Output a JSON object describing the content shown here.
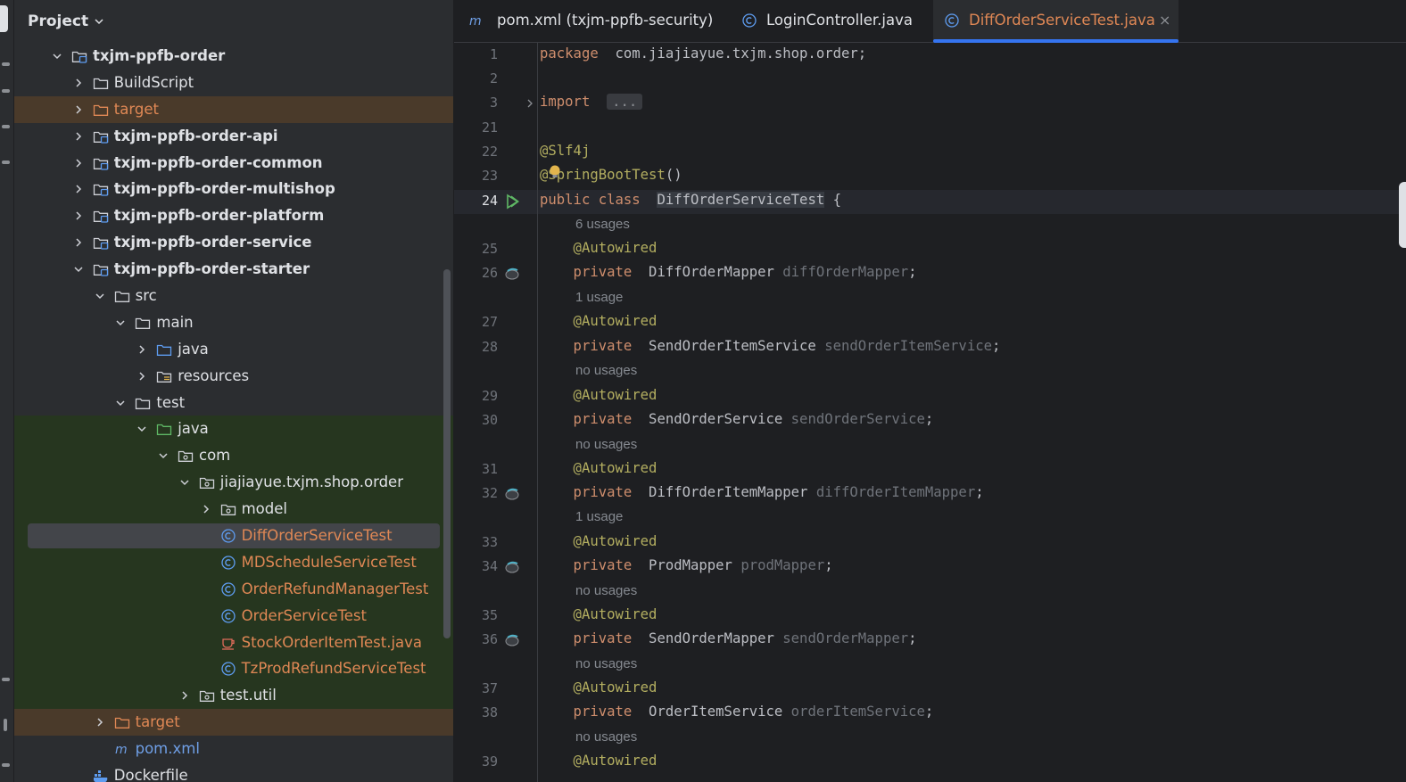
{
  "project_panel": {
    "title": "Project",
    "tree": [
      {
        "label": "txjm-ppfb-order",
        "depth": 1,
        "expanded": true,
        "icon": "module-folder-icon",
        "bold": true
      },
      {
        "label": "BuildScript",
        "depth": 2,
        "expanded": false,
        "icon": "folder-icon"
      },
      {
        "label": "target",
        "depth": 2,
        "expanded": false,
        "icon": "excluded-folder-icon",
        "state": "excluded"
      },
      {
        "label": "txjm-ppfb-order-api",
        "depth": 2,
        "expanded": false,
        "icon": "module-folder-icon",
        "bold": true
      },
      {
        "label": "txjm-ppfb-order-common",
        "depth": 2,
        "expanded": false,
        "icon": "module-folder-icon",
        "bold": true
      },
      {
        "label": "txjm-ppfb-order-multishop",
        "depth": 2,
        "expanded": false,
        "icon": "module-folder-icon",
        "bold": true
      },
      {
        "label": "txjm-ppfb-order-platform",
        "depth": 2,
        "expanded": false,
        "icon": "module-folder-icon",
        "bold": true
      },
      {
        "label": "txjm-ppfb-order-service",
        "depth": 2,
        "expanded": false,
        "icon": "module-folder-icon",
        "bold": true
      },
      {
        "label": "txjm-ppfb-order-starter",
        "depth": 2,
        "expanded": true,
        "icon": "module-folder-icon",
        "bold": true
      },
      {
        "label": "src",
        "depth": 3,
        "expanded": true,
        "icon": "folder-icon"
      },
      {
        "label": "main",
        "depth": 4,
        "expanded": true,
        "icon": "folder-icon"
      },
      {
        "label": "java",
        "depth": 5,
        "expanded": false,
        "icon": "source-folder-icon"
      },
      {
        "label": "resources",
        "depth": 5,
        "expanded": false,
        "icon": "resources-folder-icon"
      },
      {
        "label": "test",
        "depth": 4,
        "expanded": true,
        "icon": "folder-icon"
      },
      {
        "label": "java",
        "depth": 5,
        "expanded": true,
        "icon": "test-folder-icon",
        "state": "test"
      },
      {
        "label": "com",
        "depth": 6,
        "expanded": true,
        "icon": "package-icon",
        "state": "test"
      },
      {
        "label": "jiajiayue.txjm.shop.order",
        "depth": 7,
        "expanded": true,
        "icon": "package-icon",
        "state": "test"
      },
      {
        "label": "model",
        "depth": 8,
        "expanded": false,
        "icon": "package-icon",
        "state": "test"
      },
      {
        "label": "DiffOrderServiceTest",
        "depth": 8,
        "icon": "class-icon",
        "state": "test",
        "color": "orange",
        "selected": true
      },
      {
        "label": "MDScheduleServiceTest",
        "depth": 8,
        "icon": "class-icon",
        "state": "test",
        "color": "orange"
      },
      {
        "label": "OrderRefundManagerTest",
        "depth": 8,
        "icon": "class-icon",
        "state": "test",
        "color": "orange"
      },
      {
        "label": "OrderServiceTest",
        "depth": 8,
        "icon": "class-icon",
        "state": "test",
        "color": "orange"
      },
      {
        "label": "StockOrderItemTest.java",
        "depth": 8,
        "icon": "java-file-icon",
        "state": "test",
        "color": "orange"
      },
      {
        "label": "TzProdRefundServiceTest",
        "depth": 8,
        "icon": "class-icon",
        "state": "test",
        "color": "orange"
      },
      {
        "label": "test.util",
        "depth": 7,
        "expanded": false,
        "icon": "package-icon",
        "state": "test"
      },
      {
        "label": "target",
        "depth": 3,
        "expanded": false,
        "icon": "excluded-folder-icon",
        "state": "excluded",
        "color": "orange"
      },
      {
        "label": "pom.xml",
        "depth": 3,
        "icon": "maven-icon",
        "color": "blue"
      },
      {
        "label": "Dockerfile",
        "depth": 2,
        "icon": "docker-icon"
      }
    ]
  },
  "tabs": [
    {
      "label": "pom.xml (txjm-ppfb-security)",
      "icon": "maven-icon",
      "active": false
    },
    {
      "label": "LoginController.java",
      "icon": "class-icon",
      "active": false
    },
    {
      "label": "DiffOrderServiceTest.java",
      "icon": "class-icon",
      "active": true,
      "close": "×"
    }
  ],
  "editor": {
    "lines": [
      {
        "n": "1",
        "parts": [
          [
            "kw",
            "package"
          ],
          [
            "",
            "  com.jiajiayue.txjm.shop.order;"
          ]
        ]
      },
      {
        "n": "2",
        "parts": []
      },
      {
        "n": "3",
        "parts": [
          [
            "kw",
            "import"
          ],
          [
            "",
            "  "
          ],
          [
            "fold",
            "..."
          ]
        ],
        "fold": true
      },
      {
        "n": "21",
        "parts": []
      },
      {
        "n": "22",
        "parts": [
          [
            "ann",
            "@Slf4j"
          ]
        ]
      },
      {
        "n": "23",
        "parts": [
          [
            "ann",
            "@SpringBootTest"
          ],
          [
            "",
            "()"
          ]
        ],
        "bulb": true
      },
      {
        "n": "24",
        "parts": [
          [
            "kw",
            "public class"
          ],
          [
            "",
            "  "
          ],
          [
            "cls",
            "DiffOrderServiceTest"
          ],
          [
            "",
            " {"
          ]
        ],
        "run": true,
        "current": true
      },
      {
        "hint": "6 usages"
      },
      {
        "n": "25",
        "parts": [
          [
            "ann",
            "    @Autowired"
          ]
        ]
      },
      {
        "n": "26",
        "parts": [
          [
            "kw",
            "    private"
          ],
          [
            "",
            "  DiffOrderMapper "
          ],
          [
            "fld",
            "diffOrderMapper"
          ],
          [
            "",
            ";"
          ]
        ],
        "bean": true
      },
      {
        "hint": "1 usage"
      },
      {
        "n": "27",
        "parts": [
          [
            "ann",
            "    @Autowired"
          ]
        ]
      },
      {
        "n": "28",
        "parts": [
          [
            "kw",
            "    private"
          ],
          [
            "",
            "  SendOrderItemService "
          ],
          [
            "fld",
            "sendOrderItemService"
          ],
          [
            "",
            ";"
          ]
        ]
      },
      {
        "hint": "no usages"
      },
      {
        "n": "29",
        "parts": [
          [
            "ann",
            "    @Autowired"
          ]
        ]
      },
      {
        "n": "30",
        "parts": [
          [
            "kw",
            "    private"
          ],
          [
            "",
            "  SendOrderService "
          ],
          [
            "fld",
            "sendOrderService"
          ],
          [
            "",
            ";"
          ]
        ]
      },
      {
        "hint": "no usages"
      },
      {
        "n": "31",
        "parts": [
          [
            "ann",
            "    @Autowired"
          ]
        ]
      },
      {
        "n": "32",
        "parts": [
          [
            "kw",
            "    private"
          ],
          [
            "",
            "  DiffOrderItemMapper "
          ],
          [
            "fld",
            "diffOrderItemMapper"
          ],
          [
            "",
            ";"
          ]
        ],
        "bean": true
      },
      {
        "hint": "1 usage"
      },
      {
        "n": "33",
        "parts": [
          [
            "ann",
            "    @Autowired"
          ]
        ]
      },
      {
        "n": "34",
        "parts": [
          [
            "kw",
            "    private"
          ],
          [
            "",
            "  ProdMapper "
          ],
          [
            "fld",
            "prodMapper"
          ],
          [
            "",
            ";"
          ]
        ],
        "bean": true
      },
      {
        "hint": "no usages"
      },
      {
        "n": "35",
        "parts": [
          [
            "ann",
            "    @Autowired"
          ]
        ]
      },
      {
        "n": "36",
        "parts": [
          [
            "kw",
            "    private"
          ],
          [
            "",
            "  SendOrderMapper "
          ],
          [
            "fld",
            "sendOrderMapper"
          ],
          [
            "",
            ";"
          ]
        ],
        "bean": true
      },
      {
        "hint": "no usages"
      },
      {
        "n": "37",
        "parts": [
          [
            "ann",
            "    @Autowired"
          ]
        ]
      },
      {
        "n": "38",
        "parts": [
          [
            "kw",
            "    private"
          ],
          [
            "",
            "  OrderItemService "
          ],
          [
            "fld",
            "orderItemService"
          ],
          [
            "",
            ";"
          ]
        ]
      },
      {
        "hint": "no usages"
      },
      {
        "n": "39",
        "parts": [
          [
            "ann",
            "    @Autowired"
          ]
        ]
      }
    ]
  },
  "colors": {
    "accent": "#3574f0",
    "keyword": "#cf8e6d",
    "annotation": "#b3ae60",
    "excluded_text": "#e08855",
    "test_bg": "#26361f",
    "excluded_bg": "#4a3a2a"
  }
}
